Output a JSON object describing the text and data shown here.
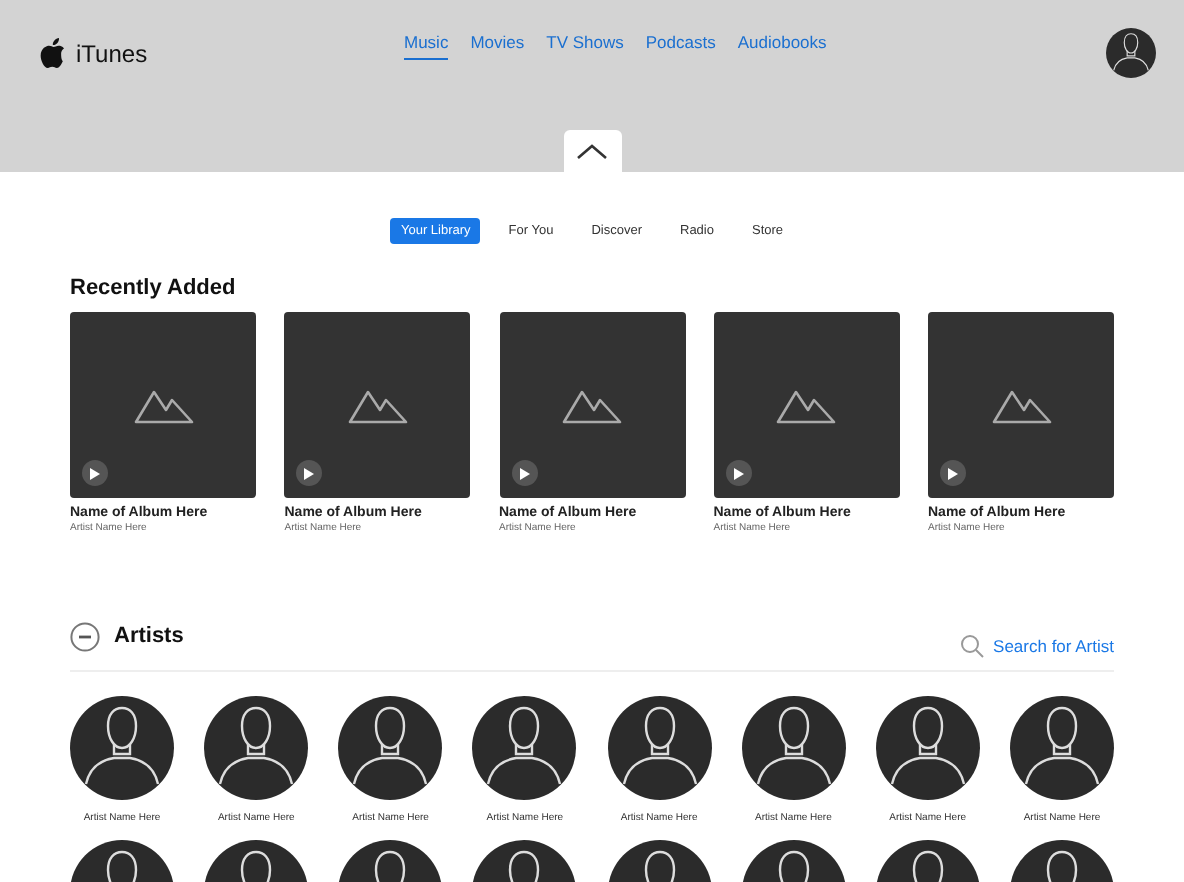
{
  "header": {
    "app_name": "iTunes",
    "nav": [
      {
        "label": "Music",
        "selected": true
      },
      {
        "label": "Movies",
        "selected": false
      },
      {
        "label": "TV Shows",
        "selected": false
      },
      {
        "label": "Podcasts",
        "selected": false
      },
      {
        "label": "Audiobooks",
        "selected": false
      }
    ]
  },
  "sub_tabs": [
    {
      "label": "Your Library",
      "selected": true
    },
    {
      "label": "For You",
      "selected": false
    },
    {
      "label": "Discover",
      "selected": false
    },
    {
      "label": "Radio",
      "selected": false
    },
    {
      "label": "Store",
      "selected": false
    }
  ],
  "recently_added": {
    "title": "Recently Added",
    "albums": [
      {
        "name": "Name of Album Here",
        "artist": "Artist Name Here"
      },
      {
        "name": "Name of Album Here",
        "artist": "Artist Name Here"
      },
      {
        "name": "Name of Album Here",
        "artist": "Artist Name Here"
      },
      {
        "name": "Name of Album Here",
        "artist": "Artist Name Here"
      },
      {
        "name": "Name of Album Here",
        "artist": "Artist Name Here"
      }
    ]
  },
  "artists": {
    "title": "Artists",
    "search_link": "Search for Artist",
    "items": [
      {
        "name": "Artist Name Here"
      },
      {
        "name": "Artist Name Here"
      },
      {
        "name": "Artist Name Here"
      },
      {
        "name": "Artist Name Here"
      },
      {
        "name": "Artist Name Here"
      },
      {
        "name": "Artist Name Here"
      },
      {
        "name": "Artist Name Here"
      },
      {
        "name": "Artist Name Here"
      }
    ],
    "next_row_partly_visible": true
  }
}
